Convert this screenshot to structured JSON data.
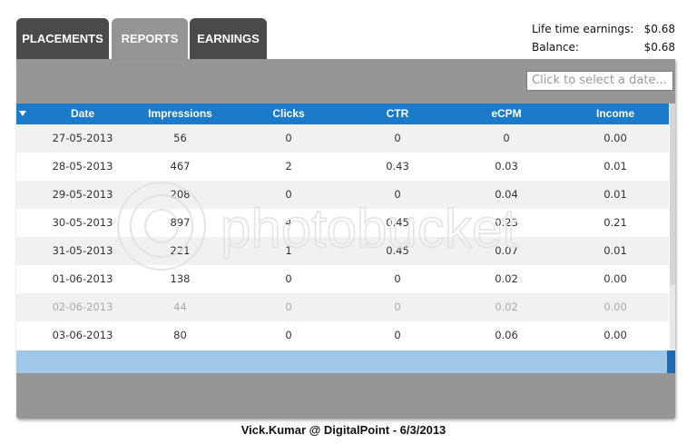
{
  "tabs": [
    {
      "label": "PLACEMENTS"
    },
    {
      "label": "REPORTS"
    },
    {
      "label": "EARNINGS"
    }
  ],
  "earnings": {
    "lifetime_label": "Life time earnings:",
    "lifetime_value": "$0.68",
    "balance_label": "Balance:",
    "balance_value": "$0.68"
  },
  "date_picker": {
    "placeholder": "Click to select a date..."
  },
  "table": {
    "headers": [
      "Date",
      "Impressions",
      "Clicks",
      "CTR",
      "eCPM",
      "Income"
    ],
    "rows": [
      [
        "27-05-2013",
        "56",
        "0",
        "0",
        "0",
        "0.00"
      ],
      [
        "28-05-2013",
        "467",
        "2",
        "0.43",
        "0.03",
        "0.01"
      ],
      [
        "29-05-2013",
        "208",
        "0",
        "0",
        "0.04",
        "0.01"
      ],
      [
        "30-05-2013",
        "897",
        "4",
        "0.45",
        "0.23",
        "0.21"
      ],
      [
        "31-05-2013",
        "221",
        "1",
        "0.45",
        "0.07",
        "0.01"
      ],
      [
        "01-06-2013",
        "138",
        "0",
        "0",
        "0.02",
        "0.00"
      ],
      [
        "02-06-2013",
        "44",
        "0",
        "0",
        "0.02",
        "0.00"
      ],
      [
        "03-06-2013",
        "80",
        "0",
        "0",
        "0.06",
        "0.00"
      ]
    ]
  },
  "watermark": "photobucket",
  "caption": "Vick.Kumar @ DigitalPoint - 6/3/2013",
  "colors": {
    "header_blue": "#1b7ac9",
    "tab_dark": "#4a4a4a",
    "tab_active": "#959595",
    "panel_gray": "#969696",
    "selection_blue": "#9ec7e8"
  }
}
